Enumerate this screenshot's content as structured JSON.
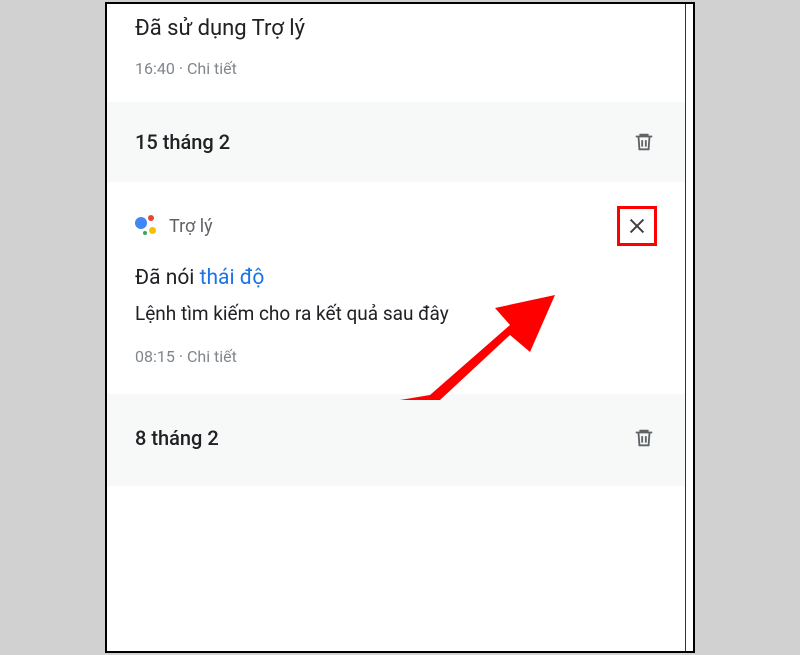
{
  "entry_top": {
    "title": "Đã sử dụng Trợ lý",
    "time": "16:40",
    "details": "Chi tiết"
  },
  "date1": {
    "label": "15 tháng 2"
  },
  "card": {
    "app": "Trợ lý",
    "said_prefix": "Đã nói ",
    "said_keyword": "thái độ",
    "result": "Lệnh tìm kiếm cho ra kết quả sau đây",
    "time": "08:15",
    "details": "Chi tiết"
  },
  "date2": {
    "label": "8 tháng 2"
  },
  "sep": " · ",
  "colors": {
    "highlight": "#f00",
    "link": "#1a73e8"
  }
}
